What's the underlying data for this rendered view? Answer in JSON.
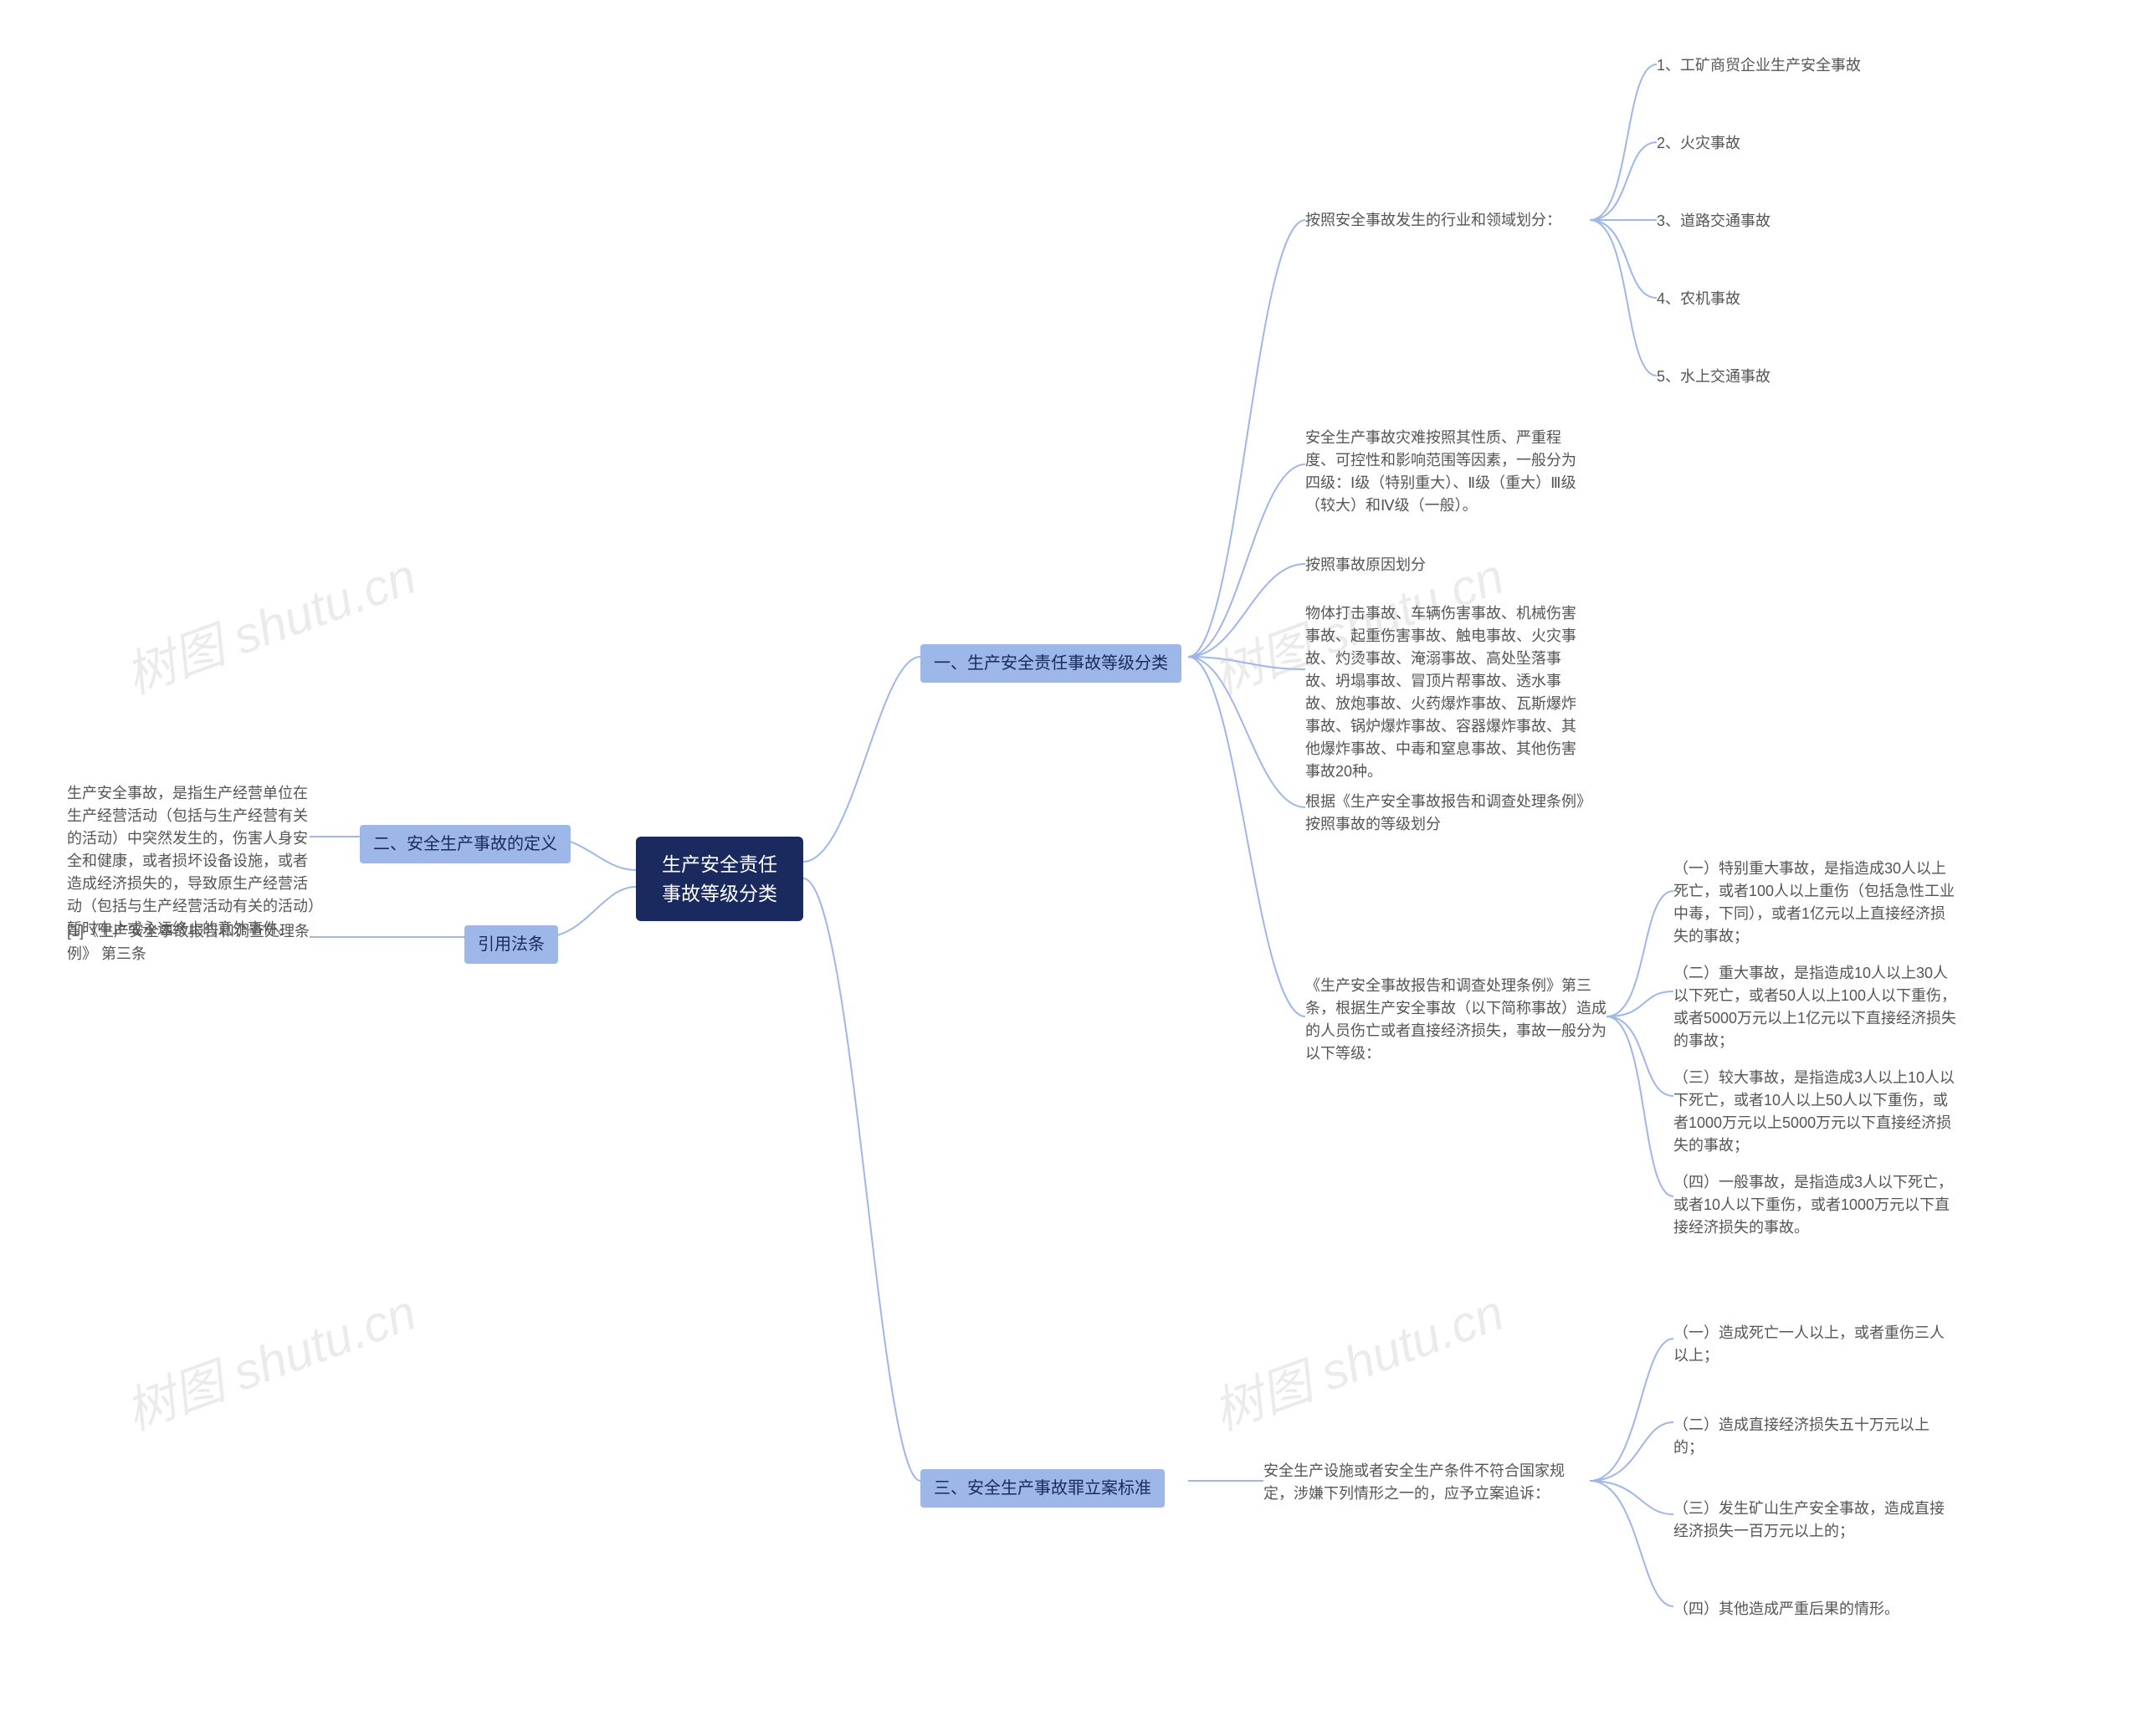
{
  "watermark": "树图 shutu.cn",
  "root": "生产安全责任事故等级分类",
  "branch1": {
    "label": "一、生产安全责任事故等级分类",
    "sub1": {
      "label": "按照安全事故发生的行业和领域划分：",
      "items": [
        "1、工矿商贸企业生产安全事故",
        "2、火灾事故",
        "3、道路交通事故",
        "4、农机事故",
        "5、水上交通事故"
      ]
    },
    "text2": "安全生产事故灾难按照其性质、严重程度、可控性和影响范围等因素，一般分为四级：Ⅰ级（特别重大）、Ⅱ级（重大）Ⅲ级（较大）和Ⅳ级（一般）。",
    "text3": "按照事故原因划分",
    "text4": "物体打击事故、车辆伤害事故、机械伤害事故、起重伤害事故、触电事故、火灾事故、灼烫事故、淹溺事故、高处坠落事故、坍塌事故、冒顶片帮事故、透水事故、放炮事故、火药爆炸事故、瓦斯爆炸事故、锅炉爆炸事故、容器爆炸事故、其他爆炸事故、中毒和窒息事故、其他伤害事故20种。",
    "text5": "根据《生产安全事故报告和调查处理条例》按照事故的等级划分",
    "sub6": {
      "label": "《生产安全事故报告和调查处理条例》第三条，根据生产安全事故（以下简称事故）造成的人员伤亡或者直接经济损失，事故一般分为以下等级：",
      "items": [
        "（一）特别重大事故，是指造成30人以上死亡，或者100人以上重伤（包括急性工业中毒，下同），或者1亿元以上直接经济损失的事故；",
        "（二）重大事故，是指造成10人以上30人以下死亡，或者50人以上100人以下重伤，或者5000万元以上1亿元以下直接经济损失的事故；",
        "（三）较大事故，是指造成3人以上10人以下死亡，或者10人以上50人以下重伤，或者1000万元以上5000万元以下直接经济损失的事故；",
        "（四）一般事故，是指造成3人以下死亡，或者10人以下重伤，或者1000万元以下直接经济损失的事故。"
      ]
    }
  },
  "branch2": {
    "label": "二、安全生产事故的定义",
    "text": "生产安全事故，是指生产经营单位在生产经营活动（包括与生产经营有关的活动）中突然发生的，伤害人身安全和健康，或者损坏设备设施，或者造成经济损失的，导致原生产经营活动（包括与生产经营活动有关的活动）暂时中止或永远终止的意外事件。"
  },
  "branch3": {
    "label": "三、安全生产事故罪立案标准",
    "text": "安全生产设施或者安全生产条件不符合国家规定，涉嫌下列情形之一的，应予立案追诉：",
    "items": [
      "（一）造成死亡一人以上，或者重伤三人以上；",
      "（二）造成直接经济损失五十万元以上的；",
      "（三）发生矿山生产安全事故，造成直接经济损失一百万元以上的；",
      "（四）其他造成严重后果的情形。"
    ]
  },
  "branch4": {
    "label": "引用法条",
    "text": "[1]《生产安全事故报告和调查处理条例》 第三条"
  }
}
